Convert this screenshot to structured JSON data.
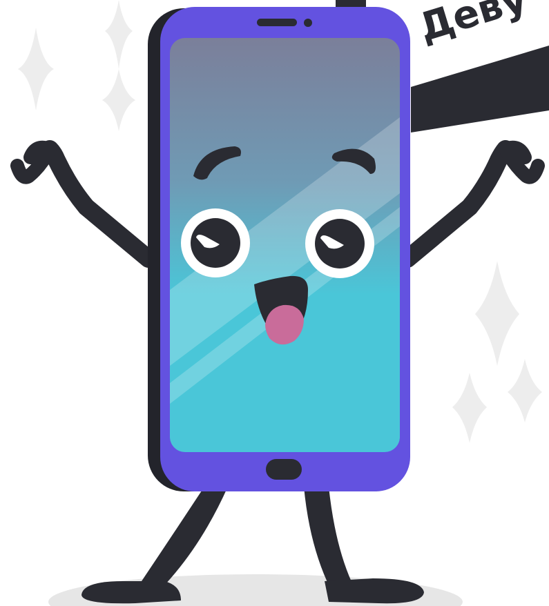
{
  "sign": {
    "text": "Деву"
  },
  "colors": {
    "phone_body": "#6352e0",
    "phone_shadow": "#23242b",
    "outline_dark": "#2a2b32",
    "screen_top": "#7b7f9a",
    "screen_mid": "#6f9bb5",
    "screen_bottom": "#4ac6d8",
    "tongue": "#c96c9a",
    "sparkle": "#ededed",
    "floor_shadow": "#e6e6e6"
  },
  "icons": {
    "character": "smartphone-mascot",
    "decor": "sparkle-star"
  }
}
